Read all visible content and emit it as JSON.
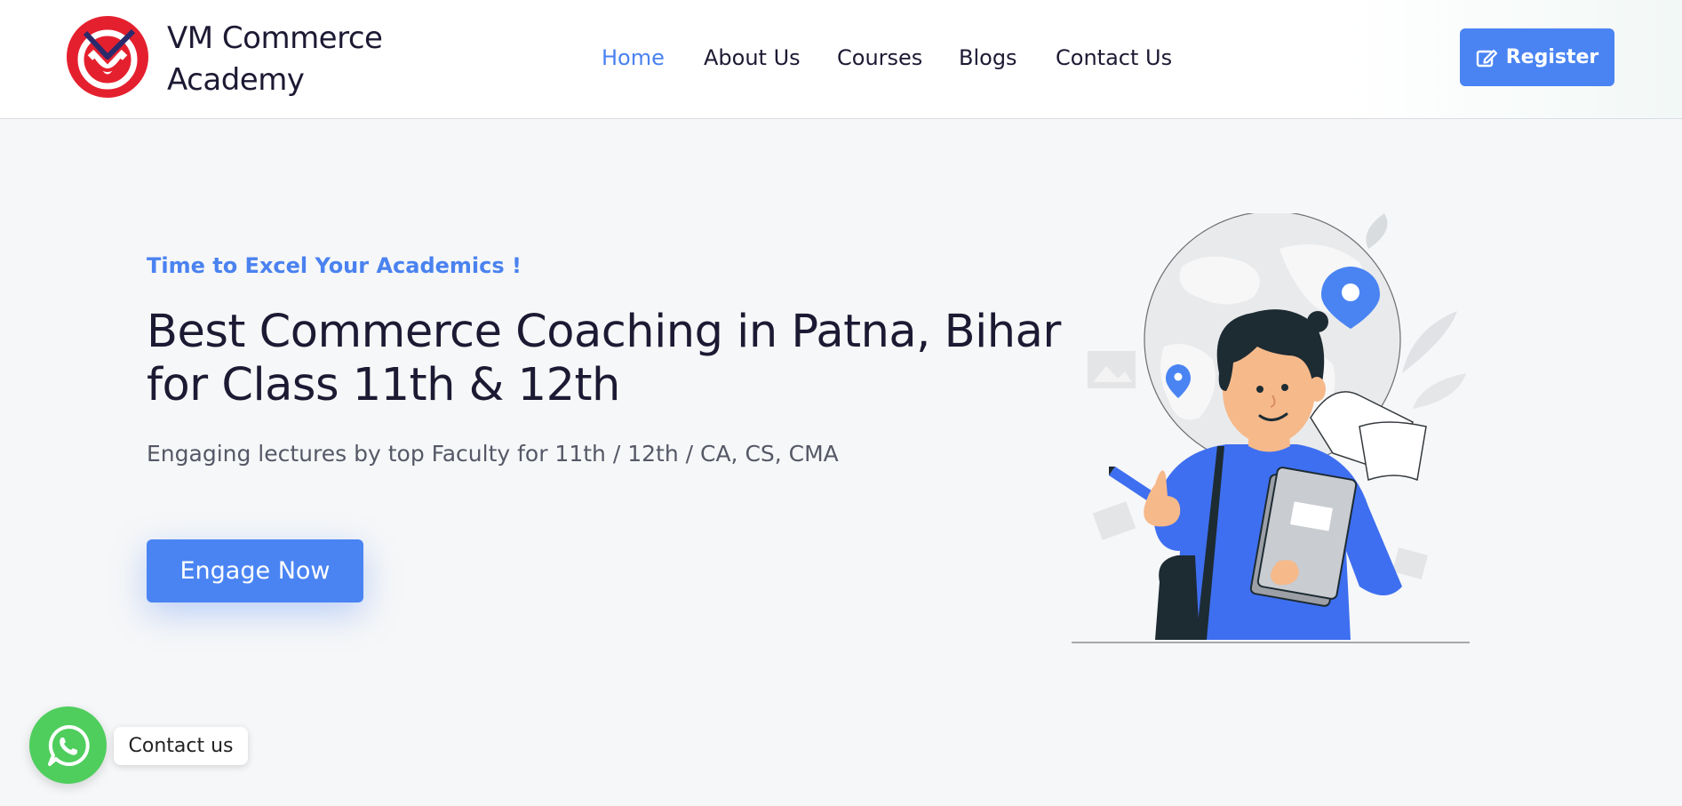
{
  "header": {
    "brand_line1": "VM Commerce",
    "brand_line2": "Academy",
    "logo_icon": "vm-logo-icon",
    "nav": [
      {
        "label": "Home",
        "active": true
      },
      {
        "label": "About Us",
        "active": false
      },
      {
        "label": "Courses",
        "active": false
      },
      {
        "label": "Blogs",
        "active": false
      },
      {
        "label": "Contact Us",
        "active": false
      }
    ],
    "register_label": "Register",
    "register_icon": "edit-icon"
  },
  "hero": {
    "tagline": "Time to Excel Your Academics !",
    "headline_line1": "Best Commerce Coaching in Patna, Bihar",
    "headline_line2": "for Class 11th & 12th",
    "subline": "Engaging lectures by top Faculty for 11th / 12th / CA, CS, CMA",
    "cta_label": "Engage Now",
    "illustration": "student-with-globe-illustration"
  },
  "whatsapp": {
    "icon": "whatsapp-icon",
    "label": "Contact us"
  },
  "colors": {
    "accent": "#4a84f3",
    "logo_red": "#e5202e",
    "logo_navy": "#2b2a6b",
    "whatsapp": "#4fce5d",
    "text_dark": "#1c1a33"
  }
}
